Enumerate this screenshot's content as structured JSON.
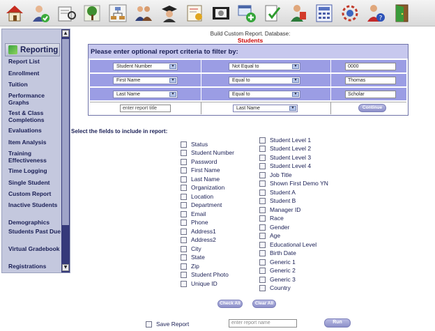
{
  "toolbar": {
    "icons": [
      "home-icon",
      "user-check-icon",
      "reading-book-icon",
      "tree-icon",
      "org-chart-icon",
      "people-icon",
      "graduate-icon",
      "certificate-icon",
      "film-icon",
      "add-window-icon",
      "document-check-icon",
      "person-book-icon",
      "calculator-icon",
      "gear-cycle-icon",
      "help-person-icon",
      "exit-door-icon"
    ]
  },
  "sidebar": {
    "header": "Reporting",
    "items": [
      "Report List",
      "Enrollment",
      "Tuition",
      "Performance Graphs",
      "Test & Class Completions",
      "Evaluations",
      "Item Analysis",
      "Training Effectiveness",
      "Time Logging",
      "Single Student",
      "Custom Report",
      "Inactive Students",
      "Demographics",
      "Students Past Due",
      "Virtual Gradebook",
      "Registrations"
    ]
  },
  "header": {
    "line1": "Build Custom Report. Database:",
    "line2": "Students"
  },
  "filter": {
    "heading": "Please enter optional report criteria to filter by:",
    "rows": [
      {
        "field": "Student Number",
        "operator": "Not Equal to",
        "value": "0000"
      },
      {
        "field": "First Name",
        "operator": "Equal to",
        "value": "Thomas"
      },
      {
        "field": "Last Name",
        "operator": "Equal to",
        "value": "Scholar"
      }
    ],
    "title_placeholder": "enter report title",
    "sort_by": "Last Name",
    "continue_label": "Continue"
  },
  "fields_label": "Select the fields to include in report:",
  "fields_left": [
    "Status",
    "Student Number",
    "Password",
    "First Name",
    "Last Name",
    "Organization",
    "Location",
    "Department",
    "Email",
    "Phone",
    "Address1",
    "Address2",
    "City",
    "State",
    "Zip",
    "Student Photo",
    "Unique ID"
  ],
  "fields_right": [
    "Student Level 1",
    "Student Level 2",
    "Student Level 3",
    "Student Level 4",
    "Job Title",
    "Shown First Demo YN",
    "Student A",
    "Student B",
    "Manager ID",
    "Race",
    "Gender",
    "Age",
    "Educational Level",
    "Birth Date",
    "Generic 1",
    "Generic 2",
    "Generic 3",
    "Country"
  ],
  "buttons": {
    "check_all": "Check All",
    "clear_all": "Clear All",
    "run": "Run"
  },
  "save": {
    "label": "Save Report",
    "placeholder": "enter report name"
  }
}
